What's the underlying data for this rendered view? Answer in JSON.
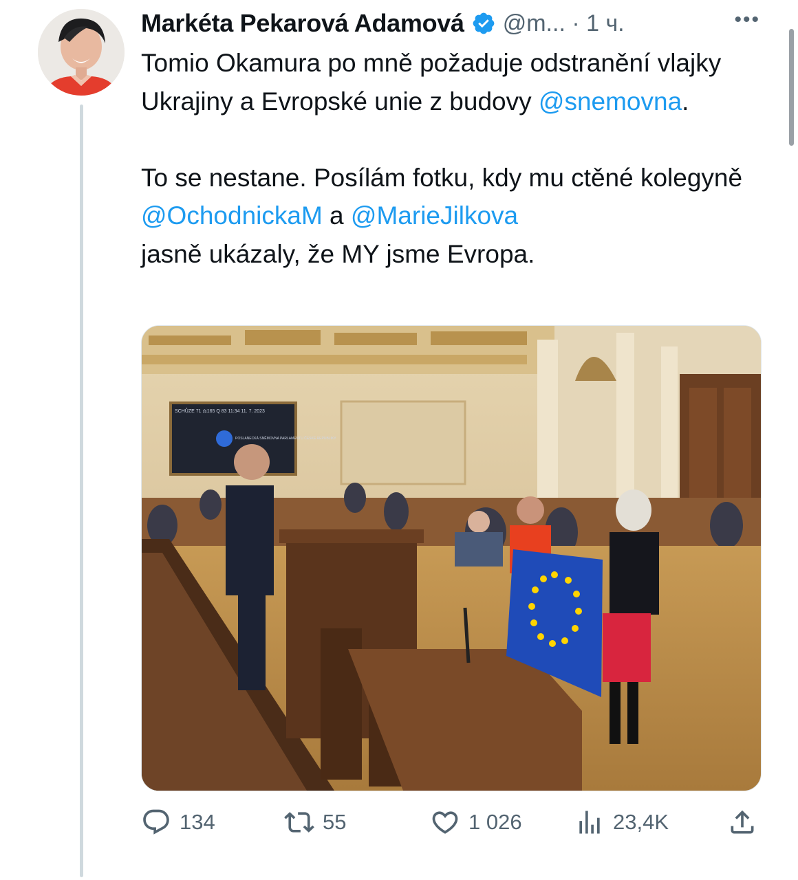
{
  "author": {
    "name": "Markéta Pekarová Adamová",
    "handle_time": "@m... · 1 ч.",
    "more_icon": "more-horizontal-icon",
    "verified_color": "#1d9bf0"
  },
  "tweet": {
    "text_before": "Tomio Okamura po mně požaduje odstranění vlajky Ukrajiny a Evropské unie z budovy ",
    "mention_1": "@snemovna",
    "text_mid_1": ".\n\nTo se nestane. Posílám fotku, kdy mu ctěné kolegyně ",
    "mention_2": "@OchodnickaM",
    "text_mid_2": " a ",
    "mention_3": "@MarieJilkova",
    "text_after": "\njasně ukázaly, že MY jsme Evropa."
  },
  "media": {
    "screen_text": "SCHŮZE 71   ⚖165   Q 83   11:34  11. 7. 2023",
    "screen_logo_text": "POSLANECKÁ SNĚMOVNA PARLAMENTU ČESKÉ REPUBLIKY"
  },
  "actions": {
    "reply": {
      "icon": "reply-icon",
      "count": "134"
    },
    "retweet": {
      "icon": "retweet-icon",
      "count": "55"
    },
    "like": {
      "icon": "heart-icon",
      "count": "1 026"
    },
    "views": {
      "icon": "views-chart-icon",
      "count": "23,4K"
    },
    "share": {
      "icon": "share-icon"
    }
  },
  "colors": {
    "accent": "#1d9bf0",
    "secondary_text": "#536471",
    "thread_line": "#cfd9de"
  }
}
